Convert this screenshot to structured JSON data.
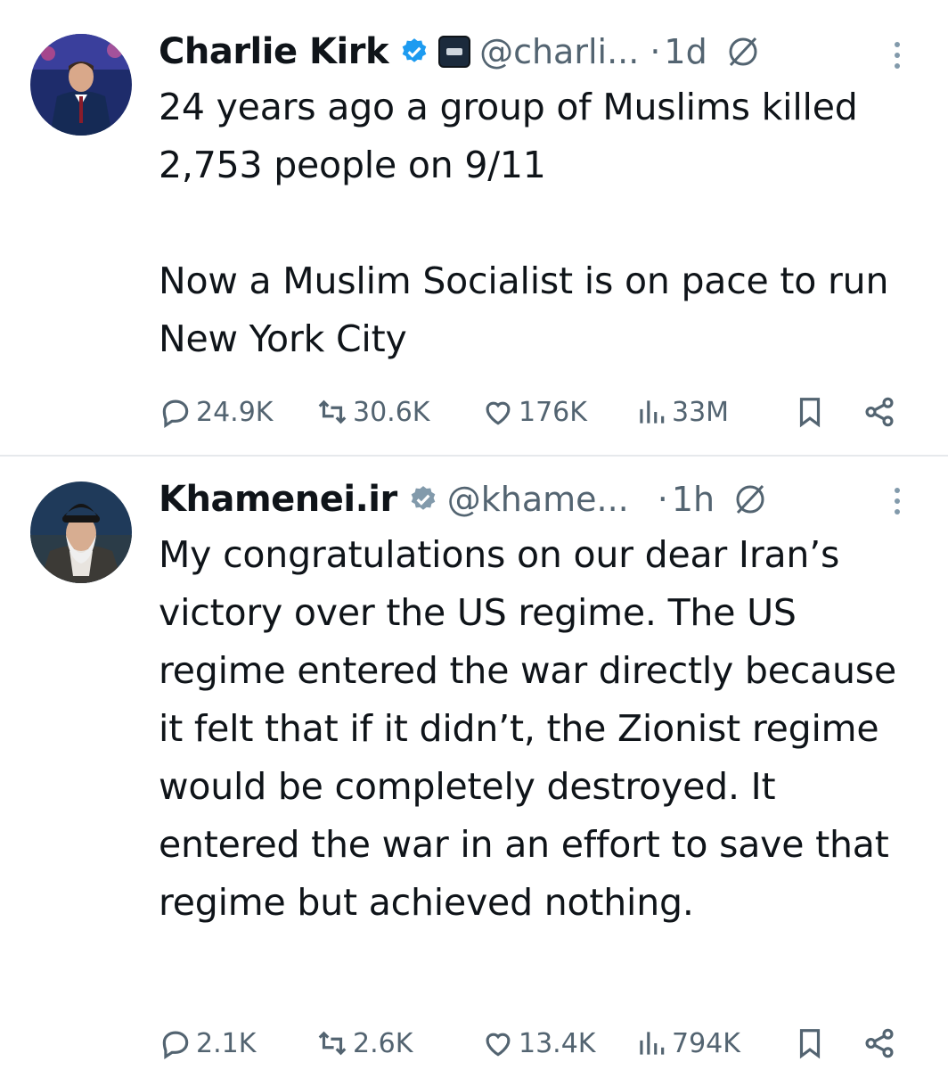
{
  "tweets": [
    {
      "author": "Charlie Kirk",
      "handle": "@charli...",
      "separator": "·",
      "time": "1d",
      "text": [
        "24 years ago a group of Muslims killed 2,753 people on 9/11",
        "Now a Muslim Socialist is on pace to run New York City"
      ],
      "stats": {
        "replies": "24.9K",
        "reposts": "30.6K",
        "likes": "176K",
        "views": "33M"
      }
    },
    {
      "author": "Khamenei.ir",
      "handle": "@khame...",
      "separator": "·",
      "time": "1h",
      "text": [
        "My congratulations on our dear Iran’s victory over the US regime. The US regime entered the war directly because it felt that if it didn’t, the Zionist regime would be completely destroyed. It entered the war in an effort to save that regime but achieved nothing."
      ],
      "stats": {
        "replies": "2.1K",
        "reposts": "2.6K",
        "likes": "13.4K",
        "views": "794K"
      }
    }
  ],
  "colors": {
    "verified_blue": "#1d9bf0",
    "verified_gray": "#829aab",
    "muted": "#536471",
    "text": "#0f1419"
  }
}
